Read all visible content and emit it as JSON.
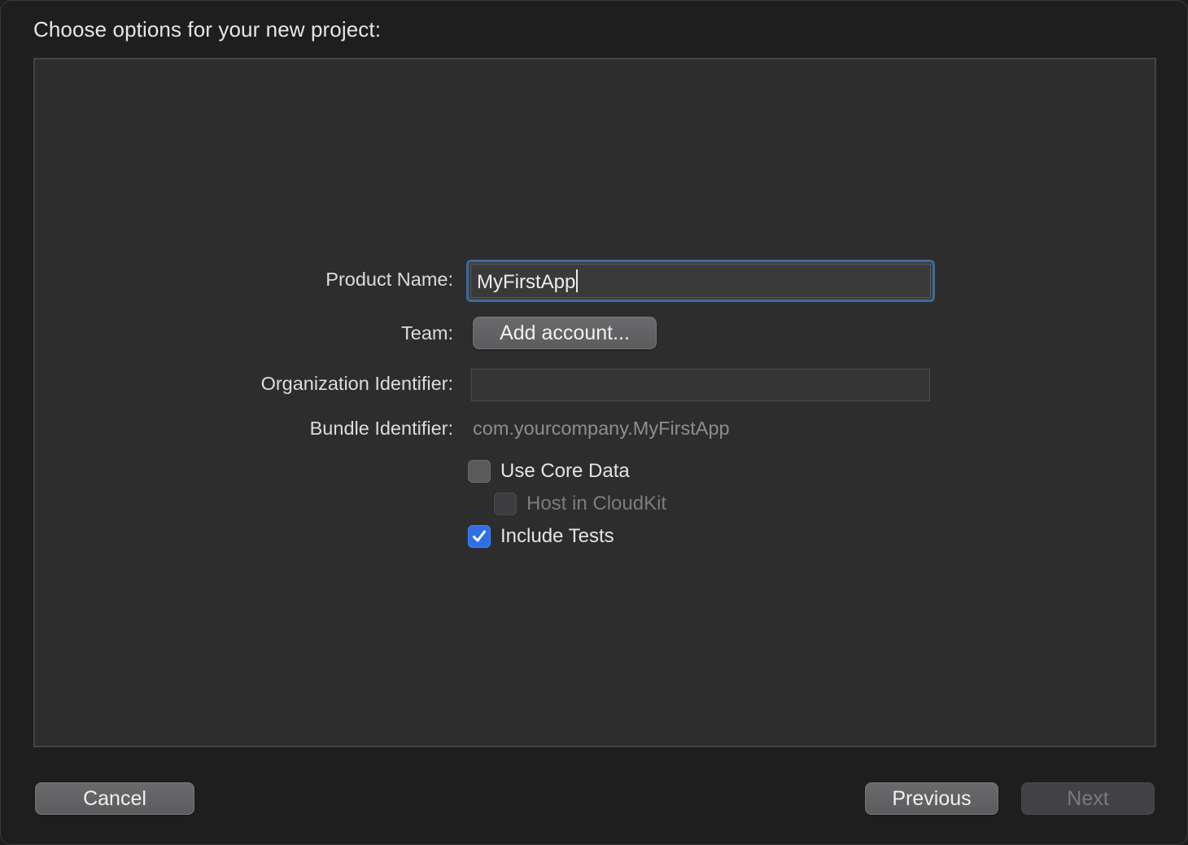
{
  "dialog": {
    "title": "Choose options for your new project:"
  },
  "form": {
    "product_name_label": "Product Name:",
    "product_name_value": "MyFirstApp",
    "team_label": "Team:",
    "add_account_label": "Add account...",
    "org_identifier_label": "Organization Identifier:",
    "org_identifier_value": "",
    "bundle_identifier_label": "Bundle Identifier:",
    "bundle_identifier_value": "com.yourcompany.MyFirstApp",
    "options": [
      {
        "label": "Use Core Data",
        "checked": false,
        "enabled": true
      },
      {
        "label": "Host in CloudKit",
        "checked": false,
        "enabled": false
      },
      {
        "label": "Include Tests",
        "checked": true,
        "enabled": true
      }
    ]
  },
  "footer": {
    "cancel_label": "Cancel",
    "previous_label": "Previous",
    "next_label": "Next",
    "next_enabled": false
  },
  "colors": {
    "focus_ring": "#3e6a9c",
    "checkbox_checked": "#2f6fe6",
    "background": "#1e1e1f",
    "panel": "#2d2d2d"
  }
}
